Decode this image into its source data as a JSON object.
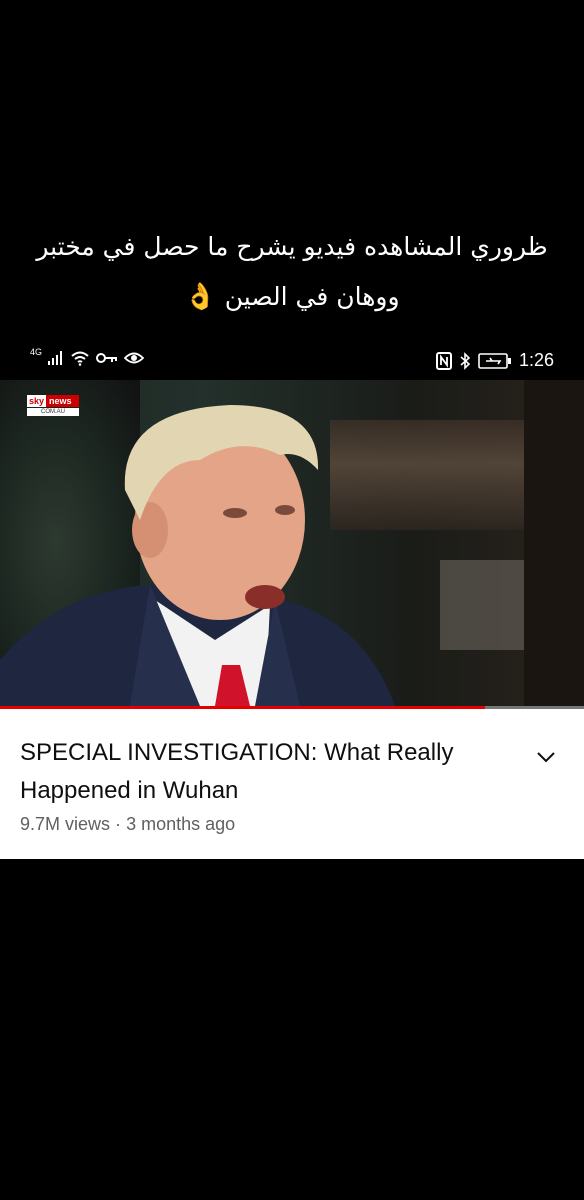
{
  "caption": {
    "line1": "ظروري المشاهده فيديو يشرح ما حصل في مختبر",
    "line2": "ووهان في الصين",
    "emoji": "👌"
  },
  "status_bar": {
    "network": "4G",
    "time": "1:26"
  },
  "video": {
    "channel_logo_top": "sky",
    "channel_logo_news": "news",
    "channel_logo_bottom": "COM.AU",
    "progress_fraction": 0.83
  },
  "details": {
    "title": "SPECIAL INVESTIGATION: What Really Happened in Wuhan",
    "views": "9.7M views",
    "separator": "·",
    "age": "3 months ago",
    "expand_icon": "chevron-down-icon"
  },
  "colors": {
    "progress": "#e50000",
    "text_primary": "#0f0f0f",
    "text_secondary": "#606060"
  }
}
